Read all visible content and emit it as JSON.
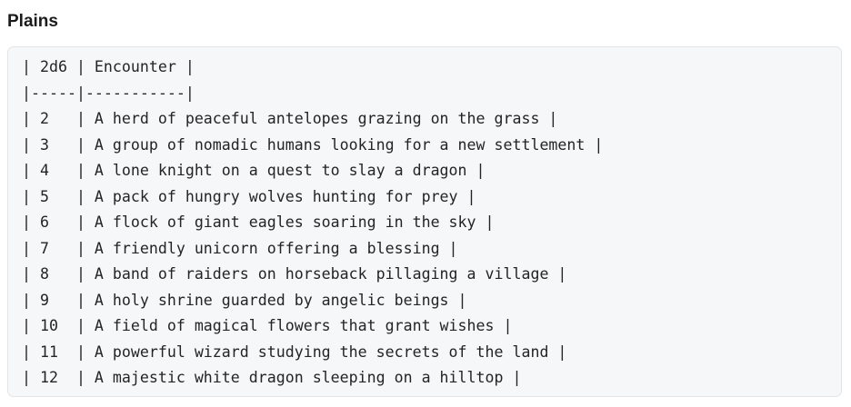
{
  "section": {
    "title": "Plains"
  },
  "code_block": {
    "lines": [
      "| 2d6 | Encounter |",
      "|-----|-----------|",
      "| 2   | A herd of peaceful antelopes grazing on the grass |",
      "| 3   | A group of nomadic humans looking for a new settlement |",
      "| 4   | A lone knight on a quest to slay a dragon |",
      "| 5   | A pack of hungry wolves hunting for prey |",
      "| 6   | A flock of giant eagles soaring in the sky |",
      "| 7   | A friendly unicorn offering a blessing |",
      "| 8   | A band of raiders on horseback pillaging a village |",
      "| 9   | A holy shrine guarded by angelic beings |",
      "| 10  | A field of magical flowers that grant wishes |",
      "| 11  | A powerful wizard studying the secrets of the land |",
      "| 12  | A majestic white dragon sleeping on a hilltop |"
    ]
  }
}
